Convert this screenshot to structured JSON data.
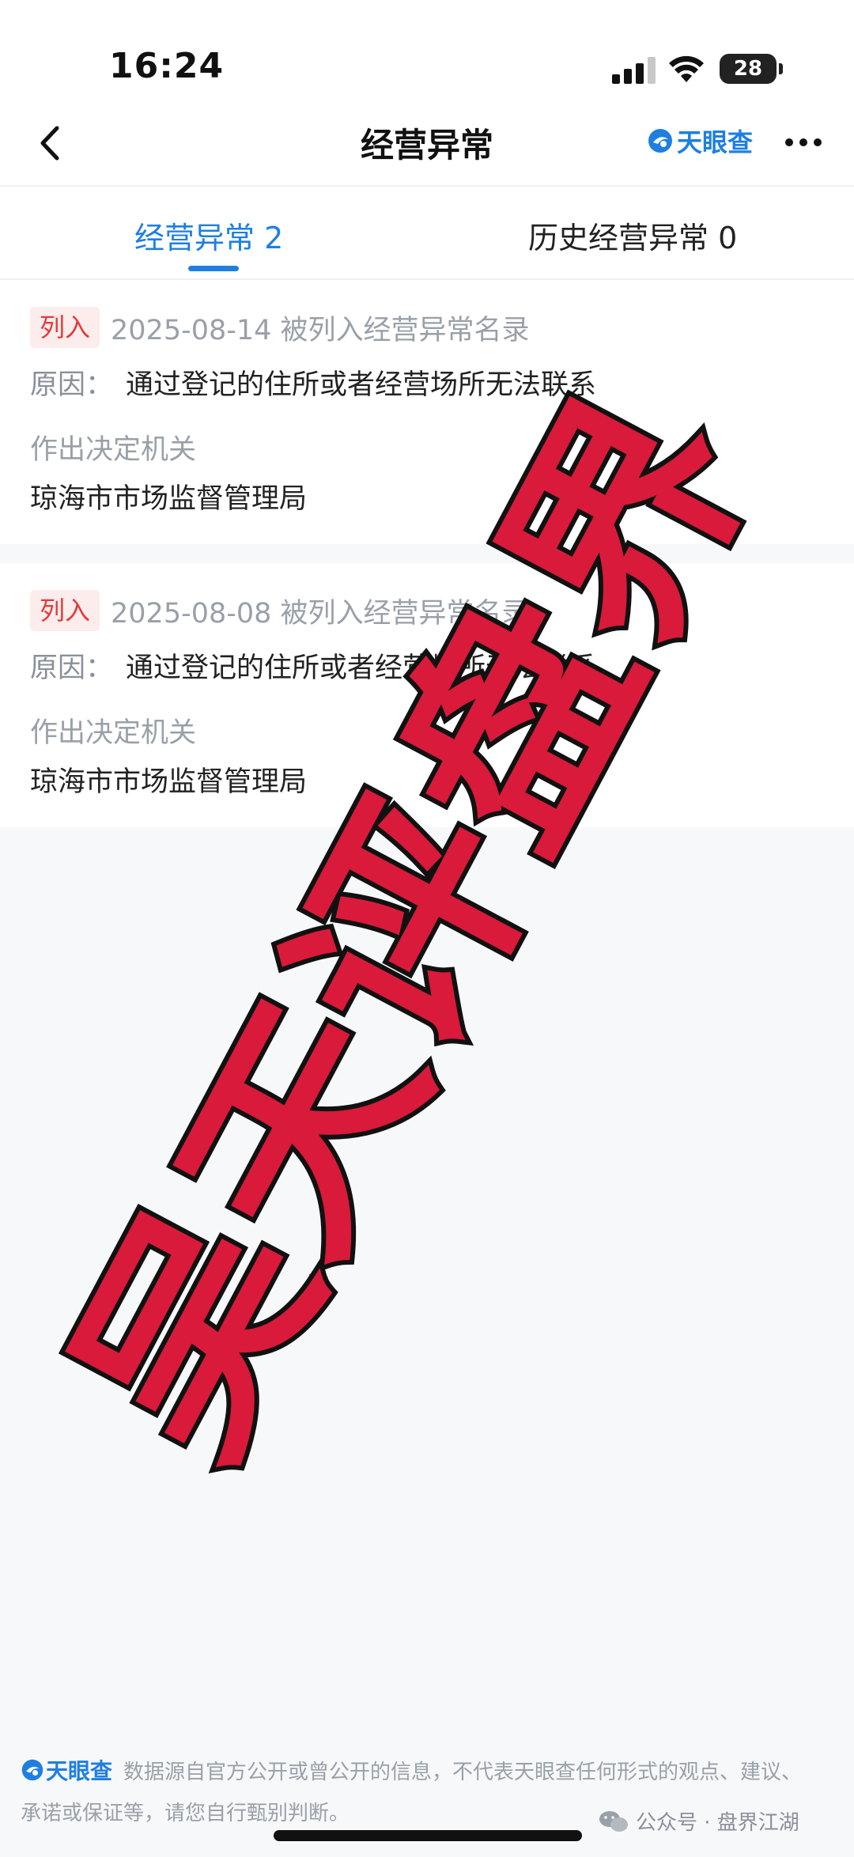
{
  "status_bar": {
    "time": "16:24",
    "battery": "28",
    "icons": [
      "signal-icon",
      "wifi-icon",
      "battery-icon"
    ]
  },
  "nav": {
    "title": "经营异常",
    "brand": "天眼查",
    "icons": [
      "back-icon",
      "more-icon"
    ]
  },
  "tabs": [
    {
      "label": "经营异常 2",
      "active": true
    },
    {
      "label": "历史经营异常 0",
      "active": false
    }
  ],
  "records": [
    {
      "tag": "列入",
      "date_text": "2025-08-14 被列入经营异常名录",
      "reason_label": "原因：",
      "reason": "通过登记的住所或者经营场所无法联系",
      "authority_label": "作出决定机关",
      "authority": "琼海市市场监督管理局"
    },
    {
      "tag": "列入",
      "date_text": "2025-08-08 被列入经营异常名录",
      "reason_label": "原因：",
      "reason": "通过登记的住所或者经营场所无法联系",
      "authority_label": "作出决定机关",
      "authority": "琼海市市场监督管理局"
    }
  ],
  "footer": {
    "brand": "天眼查",
    "disclaimer_1": "数据源自官方公开或曾公开的信息，不代表天眼查任何形式的观点、建议、",
    "disclaimer_2": "承诺或保证等，请您自行甄别判断。",
    "wechat_source": "公众号 · 盘界江湖"
  },
  "watermark": {
    "text": "吴天评盘界",
    "color": "#d91a3a"
  },
  "colors": {
    "accent": "#1e7fe0",
    "tag_bg": "#fdecec",
    "tag_text": "#e03b3b"
  }
}
